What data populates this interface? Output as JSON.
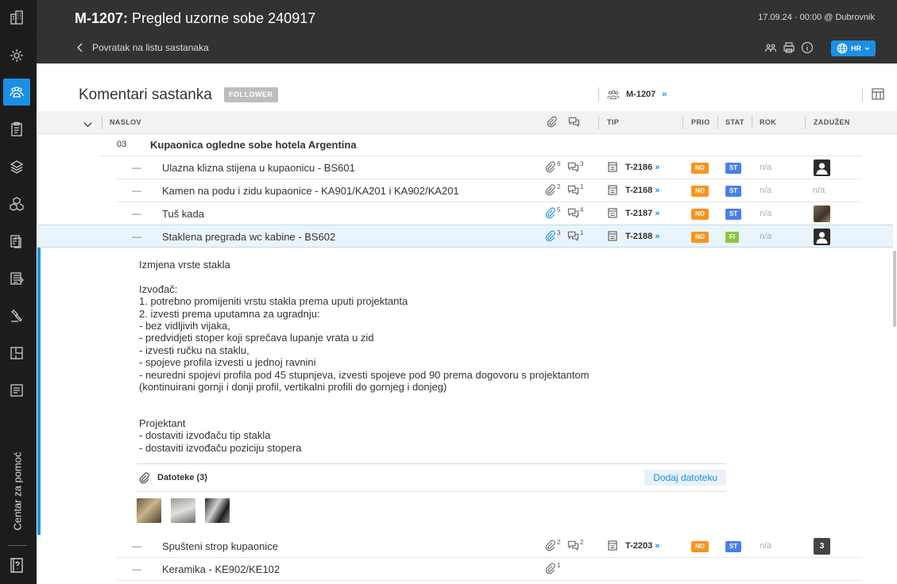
{
  "header": {
    "meeting_code": "M-1207:",
    "meeting_title": "Pregled uzorne sobe 240917",
    "datetime": "17.09.24 · 00:00 @ Dubrovnik",
    "back_label": "Povratak na listu sastanaka",
    "lang": "HR"
  },
  "rail": {
    "help_label": "Centar za pomoć"
  },
  "section": {
    "title": "Komentari sastanka",
    "badge": "FOLLOWER",
    "meeting_ref": "M-1207",
    "arrow": "»"
  },
  "columns": {
    "title": "NASLOV",
    "type": "TIP",
    "priority": "PRIO",
    "status": "STAT",
    "due": "ROK",
    "assignee": "ZADUŽEN"
  },
  "group": {
    "number": "03",
    "title": "Kupaonica ogledne sobe hotela Argentina"
  },
  "rows": [
    {
      "dash": "—",
      "title": "Ulazna klizna stijena u kupaonicu - BS601",
      "attachments": "6",
      "comments": "3",
      "ticket": "T-2186",
      "prio": "NO",
      "stat": "ST",
      "due": "n/a",
      "assignee": ""
    },
    {
      "dash": "—",
      "title": "Kamen na podu i zidu kupaonice - KA901/KA201 i KA902/KA201",
      "attachments": "2",
      "comments": "1",
      "ticket": "T-2168",
      "prio": "NO",
      "stat": "ST",
      "due": "n/a",
      "assignee": "n/a"
    },
    {
      "dash": "—",
      "title": "Tuš kada",
      "attachments": "5",
      "comments": "4",
      "ticket": "T-2187",
      "prio": "NO",
      "stat": "ST",
      "due": "n/a",
      "assignee": ""
    },
    {
      "dash": "—",
      "title": "Staklena pregrada wc kabine - BS602",
      "attachments": "3",
      "comments": "1",
      "ticket": "T-2188",
      "prio": "NO",
      "stat": "FI",
      "due": "n/a",
      "assignee": ""
    },
    {
      "dash": "—",
      "title": "Spušteni strop kupaonice",
      "attachments": "2",
      "comments": "2",
      "ticket": "T-2203",
      "prio": "NO",
      "stat": "ST",
      "due": "n/a",
      "assignee": "3"
    },
    {
      "dash": "—",
      "title": "Keramika - KE902/KE102",
      "attachments": "1"
    }
  ],
  "detail": {
    "lines": [
      "Izmjena vrste stakla",
      "",
      "Izvođač:",
      "1. potrebno promijeniti vrstu stakla prema uputi projektanta",
      "2. izvesti prema uputamna za ugradnju:",
      "- bez vidljivih vijaka,",
      "- predvidjeti stoper koji sprečava lupanje vrata u zid",
      "- izvesti ručku na staklu,",
      "- spojeve profila izvesti u jednoj ravnini",
      "- neuredni spojevi profila pod 45 stupnjeva, izvesti spojeve pod 90 prema dogovoru s projektantom",
      "(kontinuirani gornji i donji profil, vertikalni profili do gornjeg i donjeg)",
      "",
      "",
      "Projektant",
      "- dostaviti izvođaču tip stakla",
      "- dostaviti izvođaču poziciju stopera"
    ],
    "files_label": "Datoteke (3)",
    "add_files_label": "Dodaj datoteku"
  },
  "colors": {
    "accent": "#1a8fe3",
    "prio_no": "#f7941d",
    "stat_st": "#4a7fe8",
    "stat_fi": "#8bc53f"
  }
}
